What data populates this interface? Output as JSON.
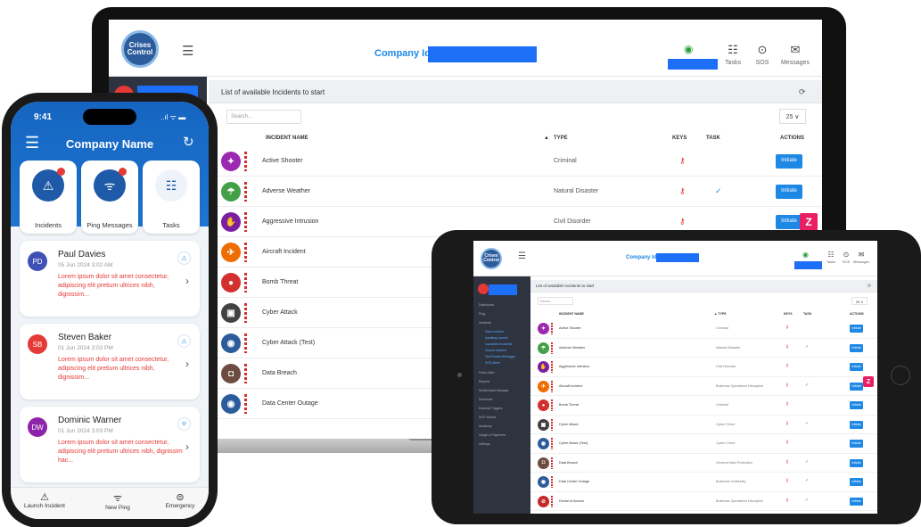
{
  "laptop": {
    "company_label": "Company Id:",
    "logo_text": "Crises Control",
    "header_items": [
      {
        "label": "Tasks",
        "icon": "list-icon"
      },
      {
        "label": "SOS",
        "icon": "sos-icon"
      },
      {
        "label": "Messages",
        "icon": "mail-icon"
      }
    ],
    "panel_title": "List of available Incidents to start",
    "search_placeholder": "Search...",
    "page_size": "25 ∨",
    "columns": {
      "name": "INCIDENT NAME",
      "type": "TYPE",
      "keys": "KEYS",
      "task": "TASK",
      "actions": "ACTIONS"
    },
    "rows": [
      {
        "name": "Active Shooter",
        "type": "Criminal",
        "key": true,
        "task": false,
        "btn": "Initiate",
        "color": "#9c27b0",
        "glyph": "✦"
      },
      {
        "name": "Adverse Weather",
        "type": "Natural Disaster",
        "key": true,
        "task": true,
        "btn": "Initiate",
        "color": "#43a047",
        "glyph": "☂"
      },
      {
        "name": "Aggressive Intrusion",
        "type": "Civil Disorder",
        "key": true,
        "task": false,
        "btn": "Initiate",
        "color": "#7b1fa2",
        "glyph": "✋"
      },
      {
        "name": "Aircraft Incident",
        "type": "",
        "key": false,
        "task": false,
        "btn": "",
        "color": "#ef6c00",
        "glyph": "✈"
      },
      {
        "name": "Bomb Threat",
        "type": "",
        "key": false,
        "task": false,
        "btn": "",
        "color": "#d32f2f",
        "glyph": "●"
      },
      {
        "name": "Cyber Attack",
        "type": "",
        "key": false,
        "task": false,
        "btn": "",
        "color": "#424242",
        "glyph": "▣"
      },
      {
        "name": "Cyber Attack (Test)",
        "type": "",
        "key": false,
        "task": false,
        "btn": "",
        "color": "#2d5c9c",
        "glyph": "◉"
      },
      {
        "name": "Data Breach",
        "type": "",
        "key": false,
        "task": false,
        "btn": "",
        "color": "#6d4c41",
        "glyph": "◘"
      },
      {
        "name": "Data Center Outage",
        "type": "",
        "key": false,
        "task": false,
        "btn": "",
        "color": "#2d5c9c",
        "glyph": "◉"
      }
    ]
  },
  "tablet": {
    "company_label": "Company Id:",
    "header_items": [
      {
        "label": "Tasks"
      },
      {
        "label": "SOS"
      },
      {
        "label": "Messages"
      }
    ],
    "panel_title": "List of available Incidents to start",
    "search_placeholder": "Search...",
    "page_size": "25 ∨",
    "columns": {
      "name": "INCIDENT NAME",
      "type": "▲ TYPE",
      "keys": "KEYS",
      "task": "TASK",
      "actions": "ACTIONS"
    },
    "sidebar": {
      "items": [
        "Dashboard",
        "Ping",
        "Incidents",
        "Public Alert",
        "Reports",
        "Media Asset Manager",
        "Scheduler",
        "External Triggers",
        "SOP Wizard",
        "Academy",
        "Usage & Payments",
        "Settings"
      ],
      "subitems": [
        "Start Incident",
        "Awaiting Launch",
        "Launched Incidents",
        "Closed Incident",
        "Test Review/Retrigger",
        "SOS Alerts"
      ]
    },
    "rows": [
      {
        "name": "Active Shooter",
        "type": "Criminal",
        "key": true,
        "task": false,
        "btn": "Initiate",
        "color": "#9c27b0",
        "glyph": "✦"
      },
      {
        "name": "Adverse Weather",
        "type": "Natural Disaster",
        "key": true,
        "task": true,
        "btn": "Initiate",
        "color": "#43a047",
        "glyph": "☂"
      },
      {
        "name": "Aggressive Intrusion",
        "type": "Civil Disorder",
        "key": true,
        "task": false,
        "btn": "Initiate",
        "color": "#7b1fa2",
        "glyph": "✋"
      },
      {
        "name": "Aircraft Incident",
        "type": "Business Operations Disruption",
        "key": true,
        "task": true,
        "btn": "Initiate",
        "color": "#ef6c00",
        "glyph": "✈"
      },
      {
        "name": "Bomb Threat",
        "type": "Criminal",
        "key": true,
        "task": false,
        "btn": "Initiate",
        "color": "#d32f2f",
        "glyph": "●"
      },
      {
        "name": "Cyber Attack",
        "type": "Cyber Crime",
        "key": true,
        "task": true,
        "btn": "Initiate",
        "color": "#424242",
        "glyph": "▣"
      },
      {
        "name": "Cyber Attack (Test)",
        "type": "Cyber Crime",
        "key": true,
        "task": false,
        "btn": "Initiate",
        "color": "#2d5c9c",
        "glyph": "◉"
      },
      {
        "name": "Data Breach",
        "type": "General Data Protection",
        "key": true,
        "task": true,
        "btn": "Initiate",
        "color": "#6d4c41",
        "glyph": "◘"
      },
      {
        "name": "Data Center Outage",
        "type": "Business Continuity",
        "key": true,
        "task": true,
        "btn": "Initiate",
        "color": "#2d5c9c",
        "glyph": "◉"
      },
      {
        "name": "Denial of Access",
        "type": "Business Operations Disruption",
        "key": true,
        "task": true,
        "btn": "Initiate",
        "color": "#c62828",
        "glyph": "⊘"
      }
    ]
  },
  "phone": {
    "time": "9:41",
    "status": "..ıl ᯤ ▬",
    "title": "Company Name",
    "tiles": [
      {
        "label": "Incidents",
        "icon": "⚠",
        "badge": "",
        "bg": "#1e5aa8",
        "fg": "#ffffff"
      },
      {
        "label": "Ping Messages",
        "icon": "ᯤ",
        "badge": "",
        "bg": "#1e5aa8",
        "fg": "#ffffff"
      },
      {
        "label": "Tasks",
        "icon": "☷",
        "badge": "",
        "bg": "#eef3fa",
        "fg": "#1e5aa8"
      }
    ],
    "cards": [
      {
        "initials": "PD",
        "name": "Paul Davies",
        "date": "05 Jun 2024   3:02 AM",
        "msg": "Lorem ipsum dolor sit amet consectetur, adipiscing elit pretium ultrices nibh, dignissim...",
        "avatar_color": "#3f51b5",
        "type_icon": "⚠"
      },
      {
        "initials": "SB",
        "name": "Steven Baker",
        "date": "01 Jun 2024   3:03 PM",
        "msg": "Lorem ipsum dolor sit amet consectetur, adipiscing elit pretium ultrices nibh, dignissim...",
        "avatar_color": "#e53935",
        "type_icon": "⚠"
      },
      {
        "initials": "DW",
        "name": "Dominic Warner",
        "date": "01 Jun 2024   3:03 PM",
        "msg": "Lorem ipsum dolor sit amet consectetur, adipiscing elit pretium ultrices nibh, dignissim hac...",
        "avatar_color": "#8e24aa",
        "type_icon": "ᯤ"
      }
    ],
    "bottom_nav": [
      {
        "label": "Launch Incident",
        "icon": "⚠"
      },
      {
        "label": "New Ping",
        "icon": "ᯤ"
      },
      {
        "label": "Emergency",
        "icon": "⊜"
      }
    ]
  }
}
